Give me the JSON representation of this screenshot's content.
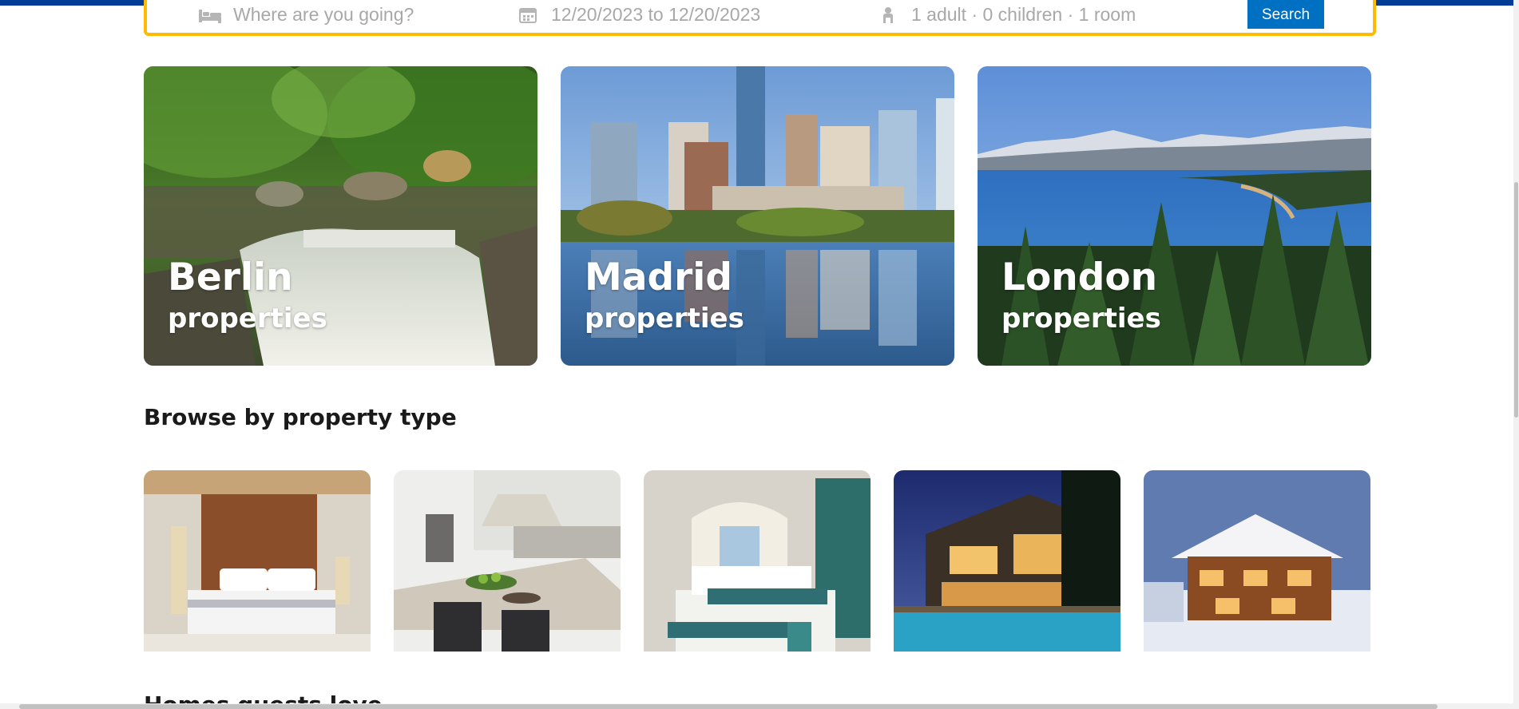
{
  "search": {
    "destination_placeholder": "Where are you going?",
    "dates": "12/20/2023 to 12/20/2023",
    "guests": "1 adult · 0 children · 1 room",
    "button_label": "Search",
    "icons": [
      "bed-icon",
      "calendar-icon",
      "person-icon"
    ]
  },
  "featured": [
    {
      "city": "Berlin",
      "subtitle": "properties"
    },
    {
      "city": "Madrid",
      "subtitle": "properties"
    },
    {
      "city": "London",
      "subtitle": "properties"
    }
  ],
  "property_types": {
    "title": "Browse by property type",
    "images": [
      "hotels-image",
      "apartments-image",
      "resorts-image",
      "villas-image",
      "cabins-image"
    ]
  },
  "next_section": {
    "title": "Homes guests love"
  },
  "colors": {
    "brand_blue": "#003b95",
    "accent_yellow": "#febb02",
    "button_blue": "#0071c2"
  }
}
